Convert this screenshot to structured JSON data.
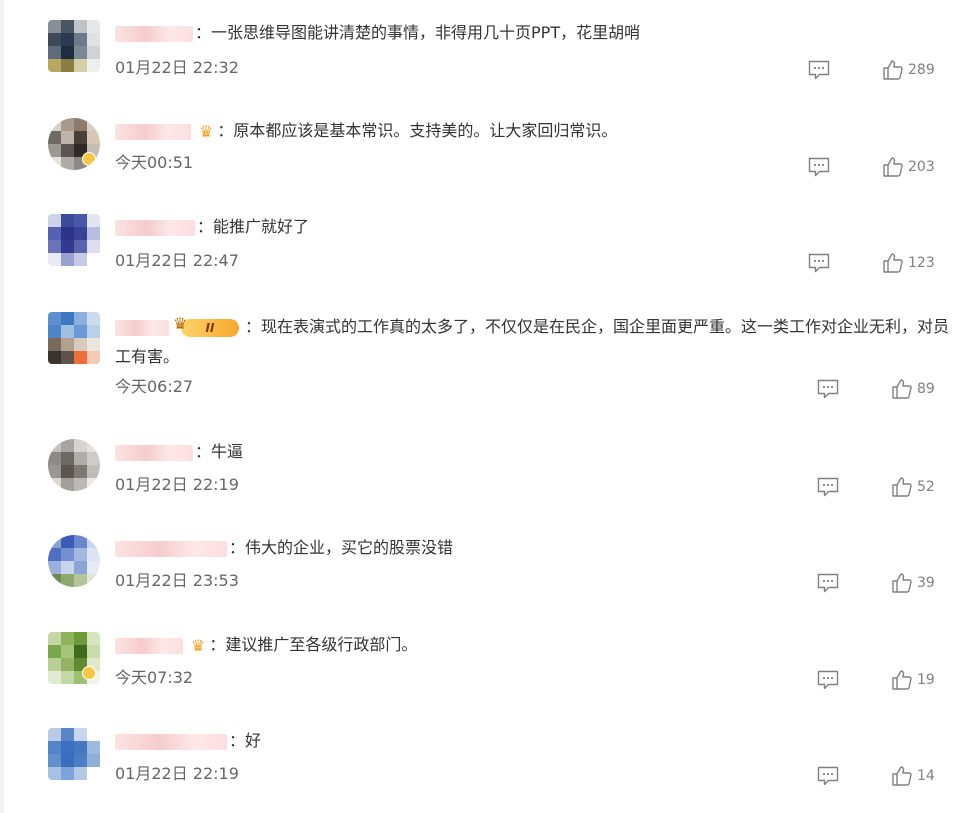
{
  "comments": [
    {
      "text": "一张思维导图能讲清楚的事情，非得用几十页PPT，花里胡哨",
      "time": "01月22日 22:32",
      "likes": "289",
      "badge": "none"
    },
    {
      "text": "原本都应该是基本常识。支持美的。让大家回归常识。",
      "time": "今天00:51",
      "likes": "203",
      "badge": "crown"
    },
    {
      "text": "能推广就好了",
      "time": "01月22日 22:47",
      "likes": "123",
      "badge": "none"
    },
    {
      "text": "现在表演式的工作真的太多了，不仅仅是在民企，国企里面更严重。这一类工作对企业无利，对员工有害。",
      "time": "今天06:27",
      "likes": "89",
      "badge": "vip-II",
      "vip_label": "II"
    },
    {
      "text": "牛逼",
      "time": "01月22日 22:19",
      "likes": "52",
      "badge": "none"
    },
    {
      "text": "伟大的企业，买它的股票没错",
      "time": "01月22日 23:53",
      "likes": "39",
      "badge": "none"
    },
    {
      "text": "建议推广至各级行政部门。",
      "time": "今天07:32",
      "likes": "19",
      "badge": "crown"
    },
    {
      "text": "好",
      "time": "01月22日 22:19",
      "likes": "14",
      "badge": "none"
    }
  ],
  "colors": {
    "text": "#333333",
    "meta": "#666666",
    "icon": "#808080",
    "vip_gold": "#f7a72a"
  },
  "icons": {
    "reply": "comment-icon",
    "like": "thumbs-up-icon",
    "vip": "crown-icon"
  }
}
